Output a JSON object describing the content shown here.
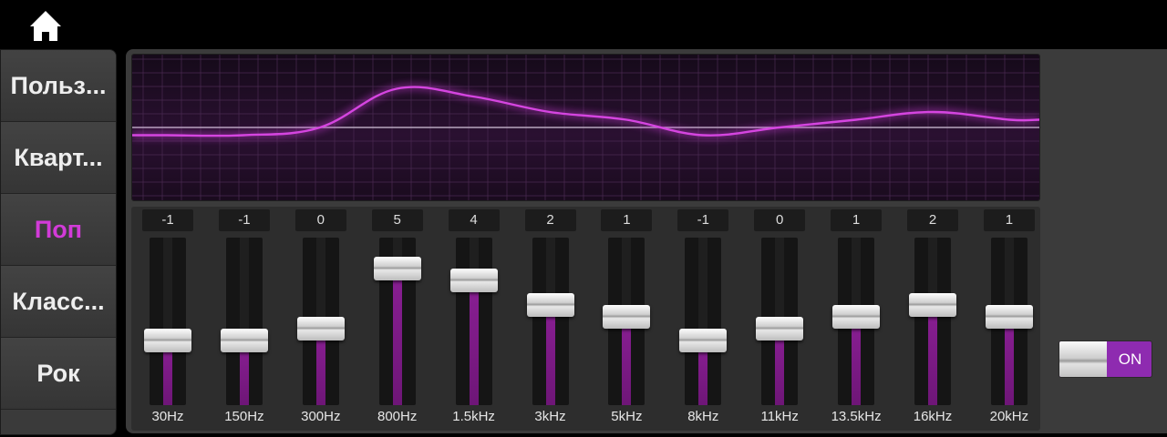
{
  "presets": [
    "Польз...",
    "Кварт...",
    "Поп",
    "Класс...",
    "Рок"
  ],
  "active_preset": "Поп",
  "accent_color": "#d23bd8",
  "bands": [
    {
      "freq": "30Hz",
      "value": -1
    },
    {
      "freq": "150Hz",
      "value": -1
    },
    {
      "freq": "300Hz",
      "value": 0
    },
    {
      "freq": "800Hz",
      "value": 5
    },
    {
      "freq": "1.5kHz",
      "value": 4
    },
    {
      "freq": "3kHz",
      "value": 2
    },
    {
      "freq": "5kHz",
      "value": 1
    },
    {
      "freq": "8kHz",
      "value": -1
    },
    {
      "freq": "11kHz",
      "value": 0
    },
    {
      "freq": "13.5kHz",
      "value": 1
    },
    {
      "freq": "16kHz",
      "value": 2
    },
    {
      "freq": "20kHz",
      "value": 1
    }
  ],
  "eq_toggle": {
    "label": "ON",
    "state": "on"
  },
  "icons": {
    "home": "home-icon"
  }
}
